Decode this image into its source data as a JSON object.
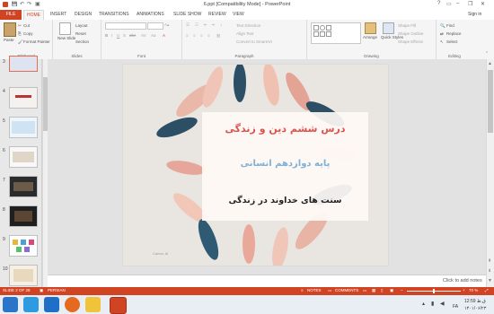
{
  "window": {
    "title": "6.ppt [Compatibility Mode] - PowerPoint",
    "signin": "Sign in"
  },
  "tabs": [
    "FILE",
    "HOME",
    "INSERT",
    "DESIGN",
    "TRANSITIONS",
    "ANIMATIONS",
    "SLIDE SHOW",
    "REVIEW",
    "VIEW"
  ],
  "ribbon": {
    "clipboard": {
      "paste": "Paste",
      "cut": "Cut",
      "copy": "Copy",
      "format_painter": "Format Painter",
      "label": "Clipboard"
    },
    "slides": {
      "new_slide": "New Slide",
      "layout": "Layout",
      "reset": "Reset",
      "section": "Section",
      "label": "Slides"
    },
    "font": {
      "label": "Font"
    },
    "paragraph": {
      "text_direction": "Text Direction",
      "align_text": "Align Text",
      "convert_smartart": "Convert to SmartArt",
      "label": "Paragraph"
    },
    "drawing": {
      "arrange": "Arrange",
      "quick_styles": "Quick Styles",
      "shape_fill": "Shape Fill",
      "shape_outline": "Shape Outline",
      "shape_effects": "Shape Effects",
      "label": "Drawing"
    },
    "editing": {
      "find": "Find",
      "replace": "Replace",
      "select": "Select",
      "label": "Editing"
    }
  },
  "thumbnails": [
    "3",
    "4",
    "5",
    "6",
    "7",
    "8",
    "9",
    "10"
  ],
  "slide": {
    "line1": "درس ششم دین و زندگی",
    "line2": "پایه دوازدهم انسانی",
    "line3": "سنت های خداوند در زندگی",
    "watermark": "Canva. AI"
  },
  "notes_placeholder": "Click to add notes",
  "status": {
    "slide_info": "SLIDE 2 OF 28",
    "language": "PERSIAN",
    "notes": "NOTES",
    "comments": "COMMENTS",
    "zoom": "70 %"
  },
  "taskbar": {
    "lang": "FA",
    "time": "12:59 ق.ظ",
    "date": "۱۴۰۱/۰۶/۲۳"
  },
  "colors": {
    "accent": "#d04423",
    "title_red": "#d9534f",
    "subtitle_blue": "#7fb0d6",
    "body_dark": "#222222"
  }
}
